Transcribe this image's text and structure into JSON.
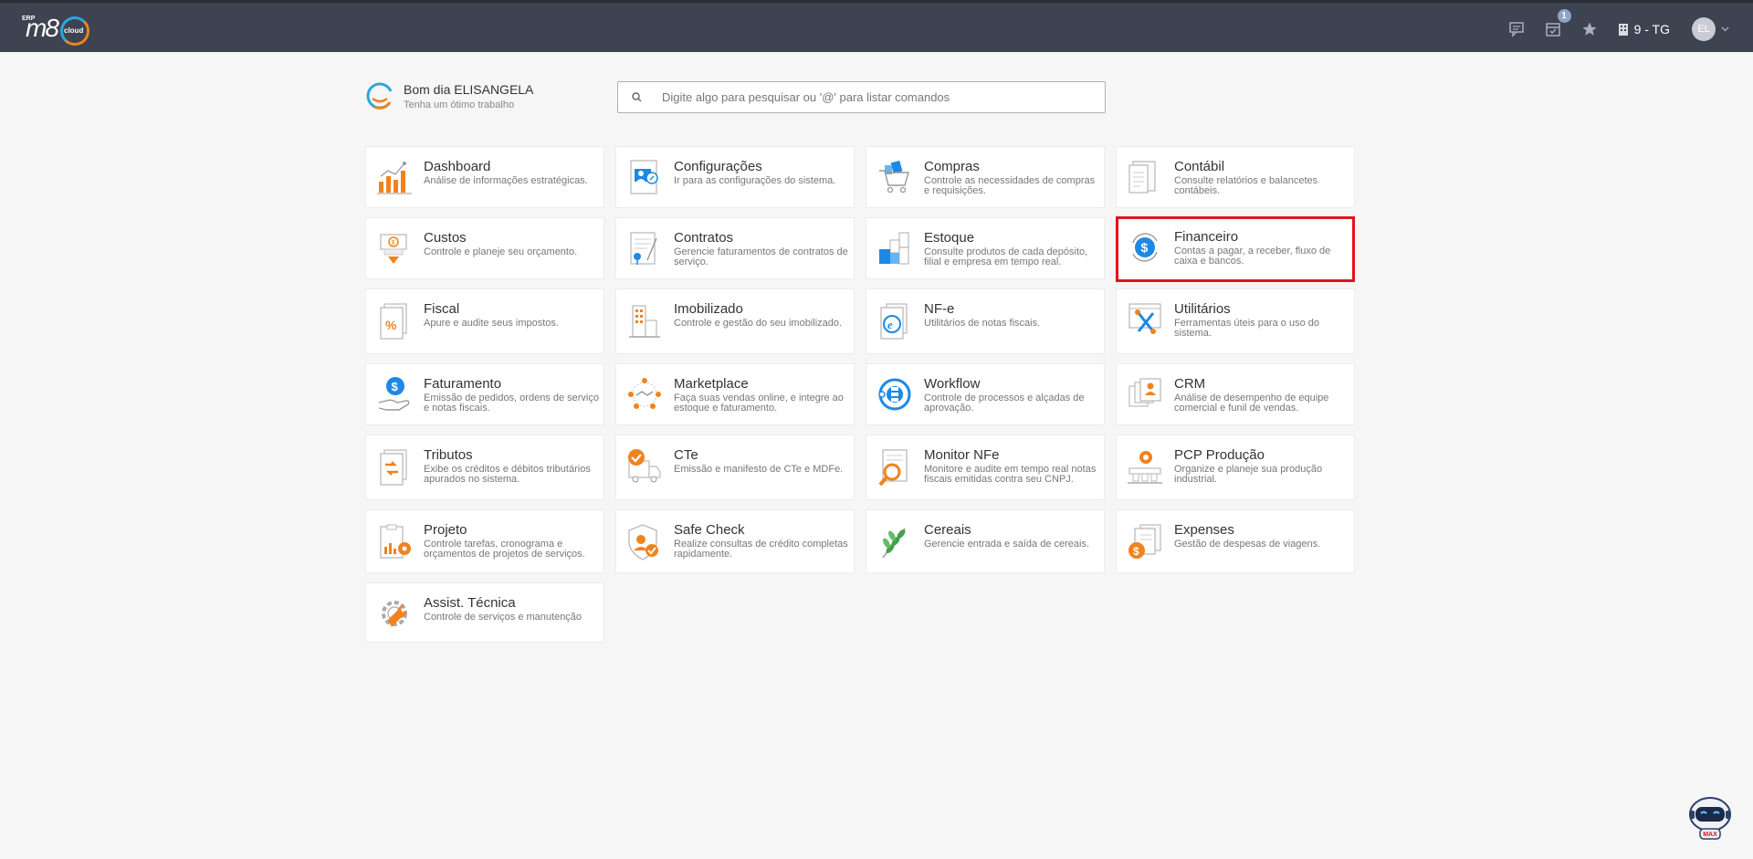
{
  "header": {
    "logo_erp": "ERP",
    "logo_m8": "m8",
    "logo_cloud": "cloud",
    "notification_count": "1",
    "company": "9 - TG",
    "avatar_initials": "EL"
  },
  "greeting": {
    "title": "Bom dia ELISANGELA",
    "subtitle": "Tenha um ótimo trabalho"
  },
  "search": {
    "placeholder": "Digite algo para pesquisar ou '@' para listar comandos"
  },
  "modules": [
    {
      "title": "Dashboard",
      "desc": "Análise de informações estratégicas.",
      "icon": "dashboard-icon"
    },
    {
      "title": "Configurações",
      "desc": "Ir para as configurações do sistema.",
      "icon": "settings-icon"
    },
    {
      "title": "Compras",
      "desc": "Controle as necessidades de compras e requisições.",
      "icon": "shopping-cart-icon"
    },
    {
      "title": "Contábil",
      "desc": "Consulte relatórios e balancetes contábeis.",
      "icon": "accounting-icon"
    },
    {
      "title": "Custos",
      "desc": "Controle e planeje seu orçamento.",
      "icon": "costs-icon"
    },
    {
      "title": "Contratos",
      "desc": "Gerencie faturamentos de contratos de serviço.",
      "icon": "contracts-icon"
    },
    {
      "title": "Estoque",
      "desc": "Consulte produtos de cada depósito, filial e empresa em tempo real.",
      "icon": "inventory-icon"
    },
    {
      "title": "Financeiro",
      "desc": "Contas a pagar, a receber, fluxo de caixa e bancos.",
      "icon": "finance-icon"
    },
    {
      "title": "Fiscal",
      "desc": "Apure e audite seus impostos.",
      "icon": "fiscal-icon"
    },
    {
      "title": "Imobilizado",
      "desc": "Controle e gestão do seu imobilizado.",
      "icon": "fixed-assets-icon"
    },
    {
      "title": "NF-e",
      "desc": "Utilitários de notas fiscais.",
      "icon": "nfe-icon"
    },
    {
      "title": "Utilitários",
      "desc": "Ferramentas úteis para o uso do sistema.",
      "icon": "tools-icon"
    },
    {
      "title": "Faturamento",
      "desc": "Emissão de pedidos, ordens de serviço e notas fiscais.",
      "icon": "billing-icon"
    },
    {
      "title": "Marketplace",
      "desc": "Faça suas vendas online, e integre ao estoque e faturamento.",
      "icon": "marketplace-icon"
    },
    {
      "title": "Workflow",
      "desc": "Controle de processos e alçadas de aprovação.",
      "icon": "workflow-icon"
    },
    {
      "title": "CRM",
      "desc": "Análise de desempenho de equipe comercial e funil de vendas.",
      "icon": "crm-icon"
    },
    {
      "title": "Tributos",
      "desc": "Exibe os créditos e débitos tributários apurados no sistema.",
      "icon": "taxes-icon"
    },
    {
      "title": "CTe",
      "desc": "Emissão e manifesto de CTe e MDFe.",
      "icon": "cte-truck-icon"
    },
    {
      "title": "Monitor NFe",
      "desc": "Monitore e audite em tempo real notas fiscais emitidas contra seu CNPJ.",
      "icon": "monitor-nfe-icon"
    },
    {
      "title": "PCP Produção",
      "desc": "Organize e planeje sua produção industrial.",
      "icon": "production-icon"
    },
    {
      "title": "Projeto",
      "desc": "Controle tarefas, cronograma e orçamentos de projetos de serviços.",
      "icon": "project-icon"
    },
    {
      "title": "Safe Check",
      "desc": "Realize consultas de crédito completas rapidamente.",
      "icon": "safe-check-icon"
    },
    {
      "title": "Cereais",
      "desc": "Gerencie entrada e saída de cereais.",
      "icon": "grain-icon"
    },
    {
      "title": "Expenses",
      "desc": "Gestão de despesas de viagens.",
      "icon": "expenses-icon"
    },
    {
      "title": "Assist. Técnica",
      "desc": "Controle de serviços e manutenção",
      "icon": "tech-support-icon"
    }
  ],
  "colors": {
    "topbar": "#3d4350",
    "accent_orange": "#f0831e",
    "accent_blue": "#1e88e5",
    "highlight": "#e0141c"
  },
  "assistant": {
    "label": "MAX"
  }
}
